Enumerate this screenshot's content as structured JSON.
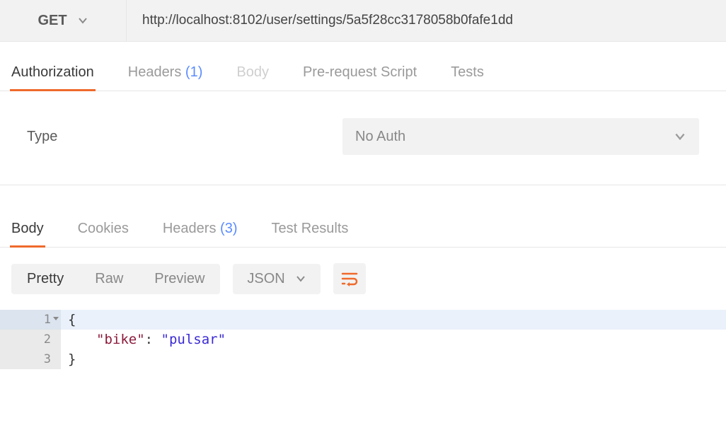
{
  "request": {
    "method": "GET",
    "url": "http://localhost:8102/user/settings/5a5f28cc3178058b0fafe1dd"
  },
  "requestTabs": {
    "authorization": "Authorization",
    "headers": {
      "label": "Headers",
      "count": "(1)"
    },
    "body": "Body",
    "prerequest": "Pre-request Script",
    "tests": "Tests"
  },
  "auth": {
    "label": "Type",
    "selected": "No Auth"
  },
  "responseTabs": {
    "body": "Body",
    "cookies": "Cookies",
    "headers": {
      "label": "Headers",
      "count": "(3)"
    },
    "testResults": "Test Results"
  },
  "viewModes": {
    "pretty": "Pretty",
    "raw": "Raw",
    "preview": "Preview"
  },
  "lang": "JSON",
  "responseBody": {
    "lines": [
      {
        "n": "1",
        "open": "{"
      },
      {
        "n": "2",
        "key": "\"bike\"",
        "sep": ": ",
        "val": "\"pulsar\""
      },
      {
        "n": "3",
        "close": "}"
      }
    ]
  }
}
